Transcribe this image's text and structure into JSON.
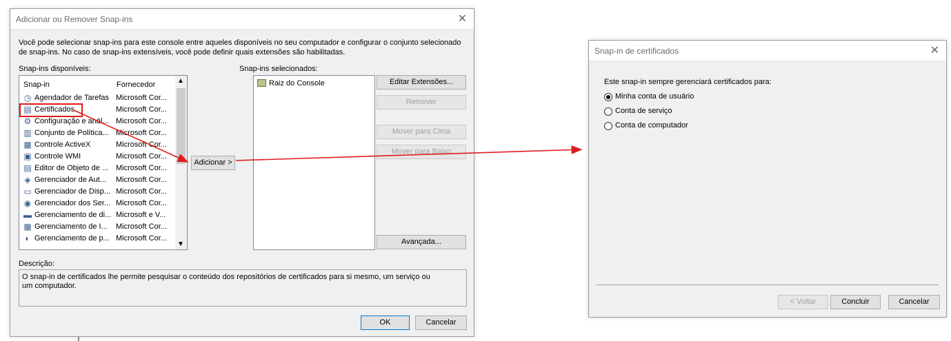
{
  "snapins_dialog": {
    "title": "Adicionar ou Remover Snap-ins",
    "intro": "Você pode selecionar snap-ins para este console entre aqueles disponíveis no seu computador e configurar o conjunto selecionado de snap-ins. No caso de snap-ins extensíveis, você pode definir quais extensões são habilitadas.",
    "available_label": "Snap-ins disponíveis:",
    "selected_label": "Snap-ins selecionados:",
    "columns": {
      "snapin": "Snap-in",
      "vendor": "Fornecedor"
    },
    "available": [
      {
        "name": "Agendador de Tarefas",
        "vendor": "Microsoft Cor...",
        "icon": "clock-icon"
      },
      {
        "name": "Certificados",
        "vendor": "Microsoft Cor...",
        "icon": "certificate-icon"
      },
      {
        "name": "Configuração e anál...",
        "vendor": "Microsoft Cor...",
        "icon": "config-icon"
      },
      {
        "name": "Conjunto de Política...",
        "vendor": "Microsoft Cor...",
        "icon": "policy-icon"
      },
      {
        "name": "Controle ActiveX",
        "vendor": "Microsoft Cor...",
        "icon": "activex-icon"
      },
      {
        "name": "Controle WMI",
        "vendor": "Microsoft Cor...",
        "icon": "wmi-icon"
      },
      {
        "name": "Editor de Objeto de ...",
        "vendor": "Microsoft Cor...",
        "icon": "document-icon"
      },
      {
        "name": "Gerenciador de Aut...",
        "vendor": "Microsoft Cor...",
        "icon": "auth-icon"
      },
      {
        "name": "Gerenciador de Disp...",
        "vendor": "Microsoft Cor...",
        "icon": "device-icon"
      },
      {
        "name": "Gerenciador dos Ser...",
        "vendor": "Microsoft Cor...",
        "icon": "server-icon"
      },
      {
        "name": "Gerenciamento de di...",
        "vendor": "Microsoft e V...",
        "icon": "disk-icon"
      },
      {
        "name": "Gerenciamento de I...",
        "vendor": "Microsoft Cor...",
        "icon": "printer-icon"
      },
      {
        "name": "Gerenciamento de p...",
        "vendor": "Microsoft Cor...",
        "icon": "policy-mgmt-icon"
      }
    ],
    "selected": [
      {
        "name": "Raiz do Console",
        "icon": "folder-icon"
      }
    ],
    "add_button": "Adicionar >",
    "edit_extensions": "Editar Extensões...",
    "remove": "Remover",
    "move_up": "Mover para Cima",
    "move_down": "Mover para Baixo",
    "advanced": "Avançada...",
    "description_label": "Descrição:",
    "description": "O snap-in de certificados lhe permite pesquisar o conteúdo dos repositórios de certificados para si mesmo, um serviço ou um computador.",
    "ok": "OK",
    "cancel": "Cancelar"
  },
  "cert_dialog": {
    "title": "Snap-in de certificados",
    "prompt": "Este snap-in sempre gerenciará certificados para:",
    "options": [
      {
        "label": "Minha conta de usuário",
        "selected": true
      },
      {
        "label": "Conta de serviço",
        "selected": false
      },
      {
        "label": "Conta de computador",
        "selected": false
      }
    ],
    "back": "< Voltar",
    "finish": "Concluir",
    "cancel": "Cancelar"
  },
  "colors": {
    "annotation": "#e01b1b",
    "accent": "#0078d7"
  }
}
